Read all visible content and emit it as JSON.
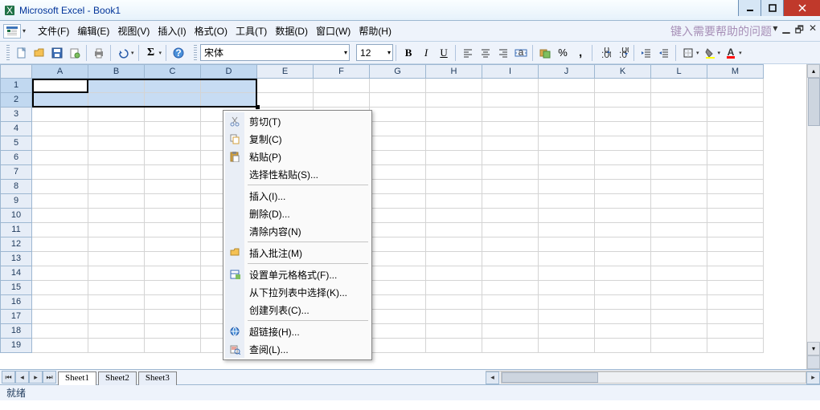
{
  "title": "Microsoft Excel - Book1",
  "menus": {
    "file": "文件(F)",
    "edit": "编辑(E)",
    "view": "视图(V)",
    "insert": "插入(I)",
    "format": "格式(O)",
    "tools": "工具(T)",
    "data": "数据(D)",
    "window": "窗口(W)",
    "help": "帮助(H)"
  },
  "help_hint": "键入需要帮助的问题",
  "font": {
    "name": "宋体",
    "size": "12"
  },
  "columns": [
    "A",
    "B",
    "C",
    "D",
    "E",
    "F",
    "G",
    "H",
    "I",
    "J",
    "K",
    "L",
    "M"
  ],
  "selected_cols": [
    "A",
    "B",
    "C",
    "D"
  ],
  "rows": [
    "1",
    "2",
    "3",
    "4",
    "5",
    "6",
    "7",
    "8",
    "9",
    "10",
    "11",
    "12",
    "13",
    "14",
    "15",
    "16",
    "17",
    "18",
    "19"
  ],
  "selected_rows": [
    "1",
    "2"
  ],
  "tabs": {
    "s1": "Sheet1",
    "s2": "Sheet2",
    "s3": "Sheet3"
  },
  "status": "就绪",
  "context": {
    "cut": "剪切(T)",
    "copy": "复制(C)",
    "paste": "粘贴(P)",
    "paste_special": "选择性粘贴(S)...",
    "insert": "插入(I)...",
    "delete": "删除(D)...",
    "clear": "清除内容(N)",
    "insert_comment": "插入批注(M)",
    "format_cells": "设置单元格格式(F)...",
    "pick_list": "从下拉列表中选择(K)...",
    "create_list": "创建列表(C)...",
    "hyperlink": "超链接(H)...",
    "lookup": "查阅(L)..."
  }
}
